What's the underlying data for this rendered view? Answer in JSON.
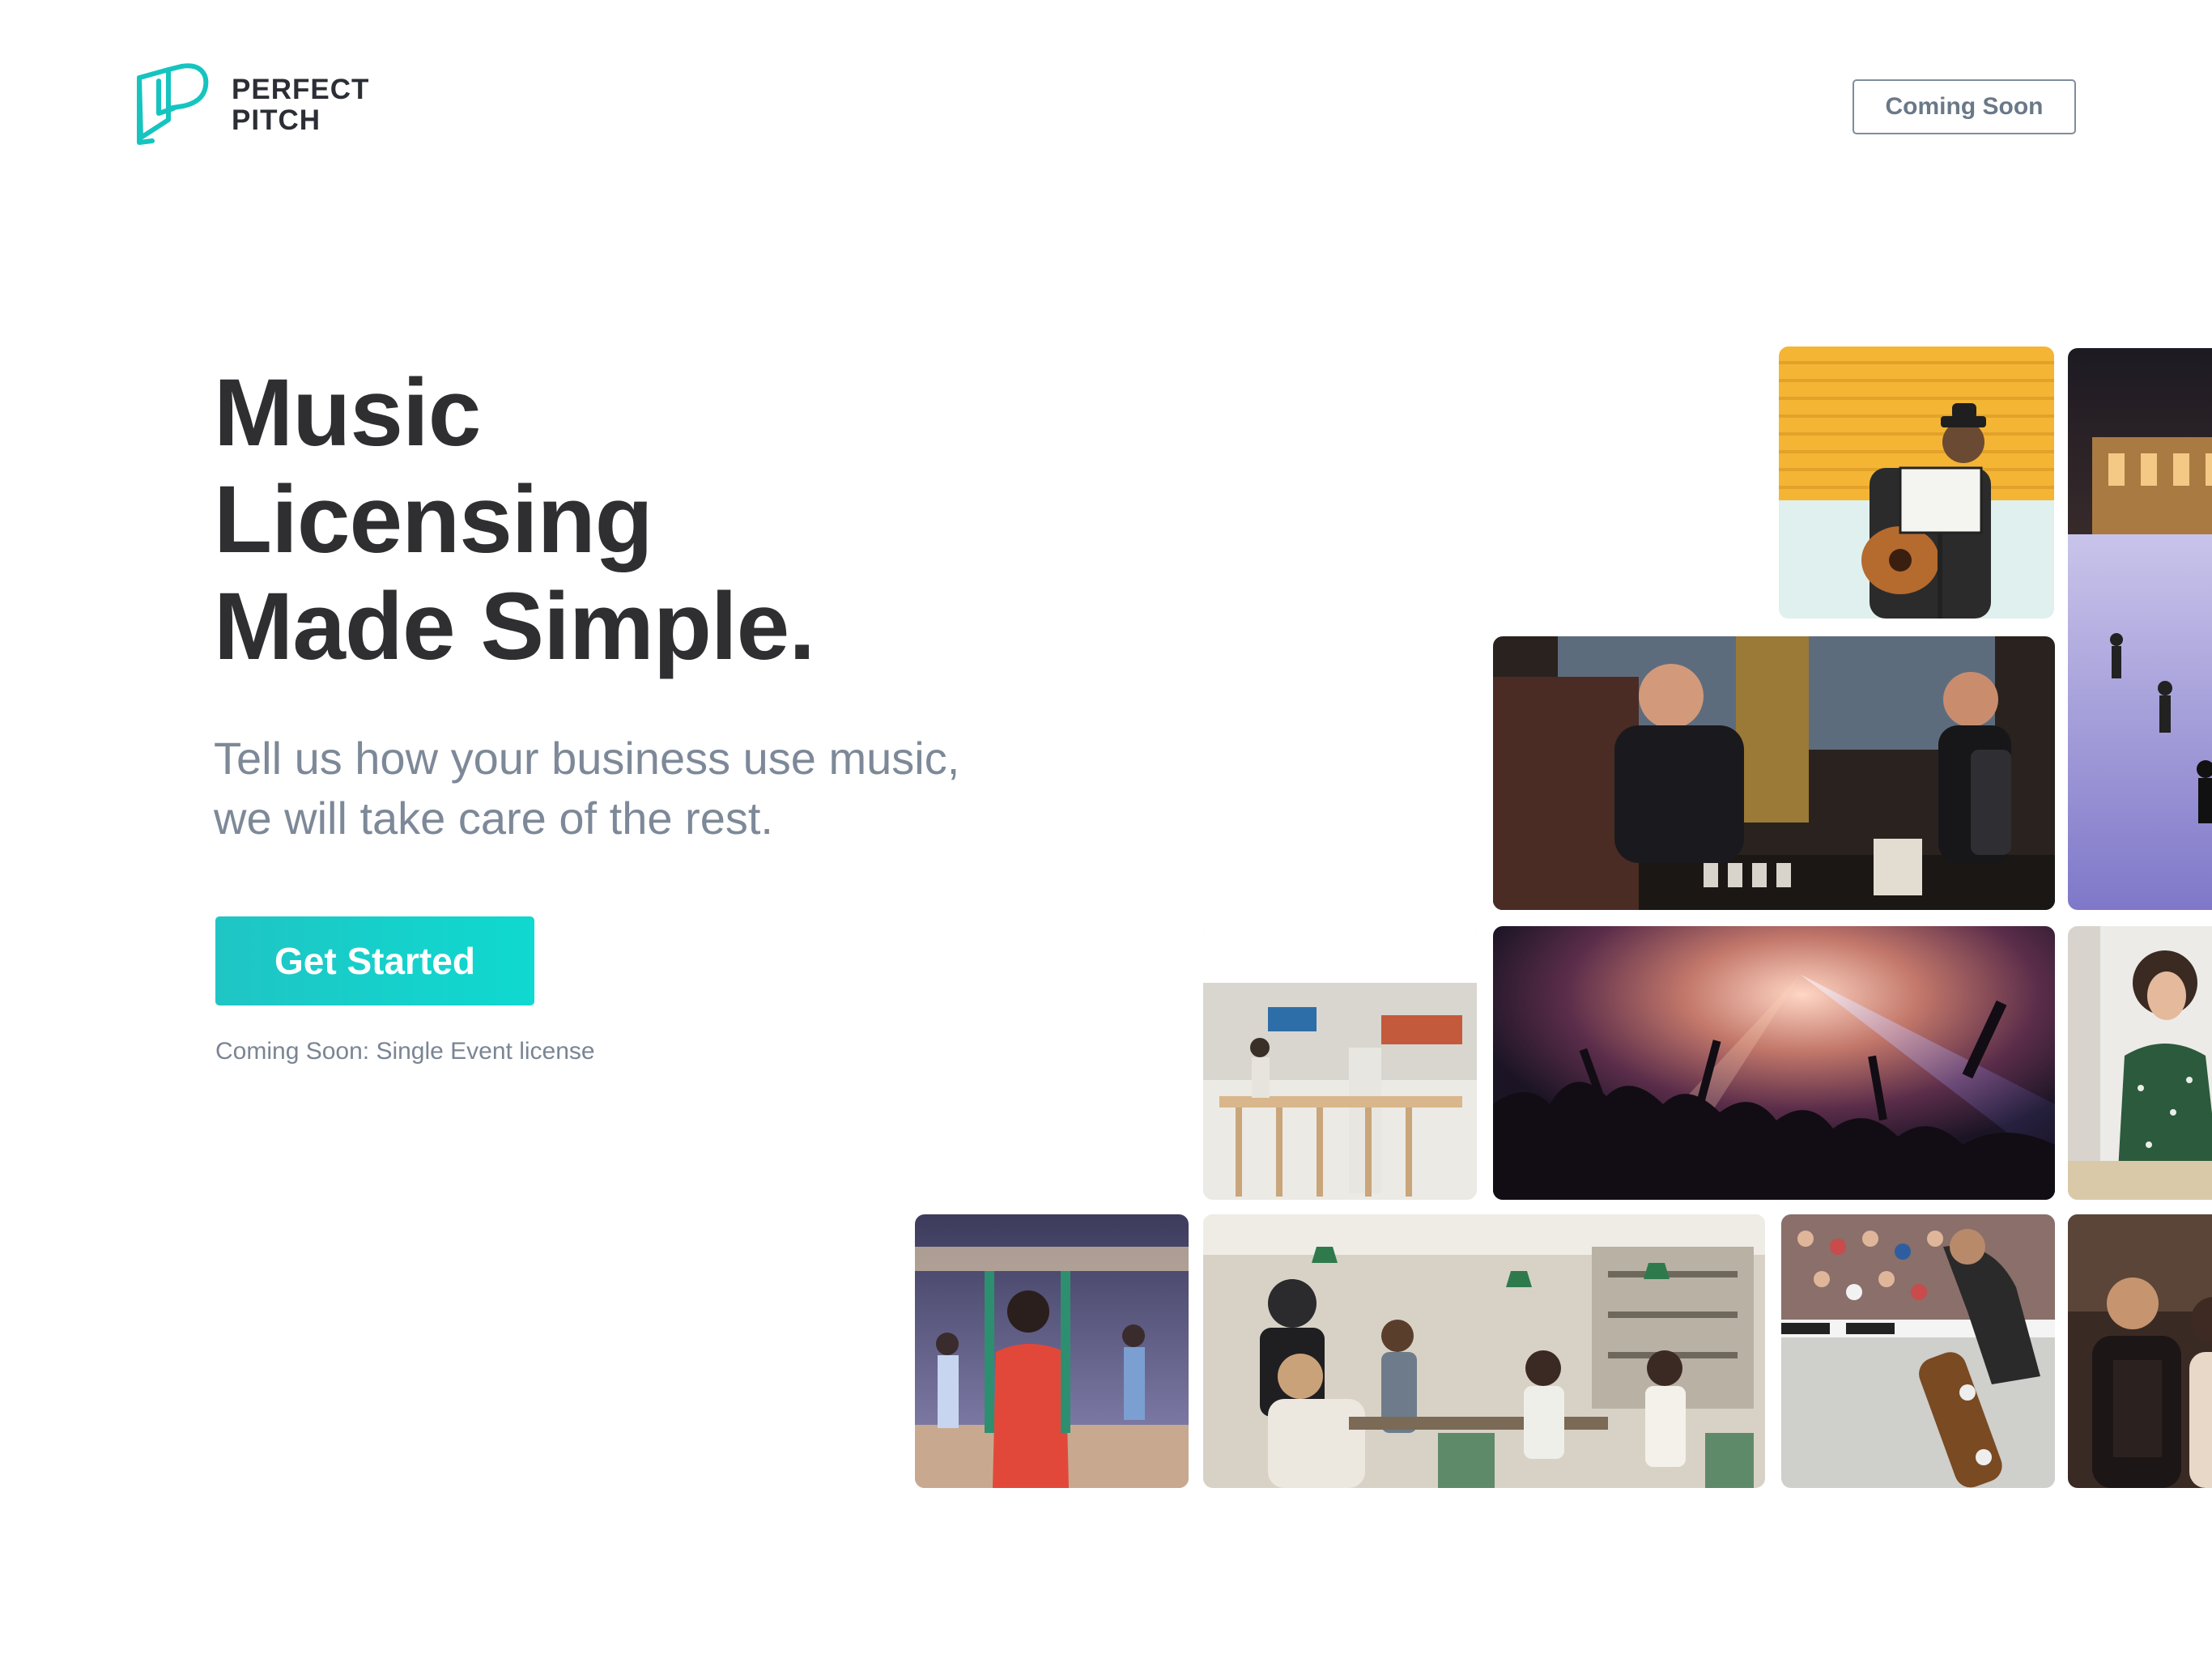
{
  "header": {
    "logo": {
      "icon": "perfect-pitch-logo-icon",
      "line1": "PERFECT",
      "line2": "PITCH",
      "color": "#16c4bf"
    },
    "coming_soon_button": "Coming Soon"
  },
  "hero": {
    "title_lines": [
      "Music",
      "Licensing",
      "Made Simple."
    ],
    "subtitle_lines": [
      "Tell us how your business use music,",
      "we will take care of the rest."
    ],
    "cta_label": "Get Started",
    "note": "Coming Soon: Single Event license"
  },
  "gallery": {
    "photos": [
      "street-musician-photo",
      "ice-skating-rink-photo",
      "bartender-photo",
      "cafe-interior-photo",
      "concert-crowd-photo",
      "shopper-photo",
      "fitness-class-photo",
      "busy-cafe-photo",
      "skateboarder-photo",
      "dancing-couple-photo"
    ]
  },
  "colors": {
    "accent": "#1ccdc6",
    "heading": "#2f2f32",
    "muted": "#7d8998"
  }
}
